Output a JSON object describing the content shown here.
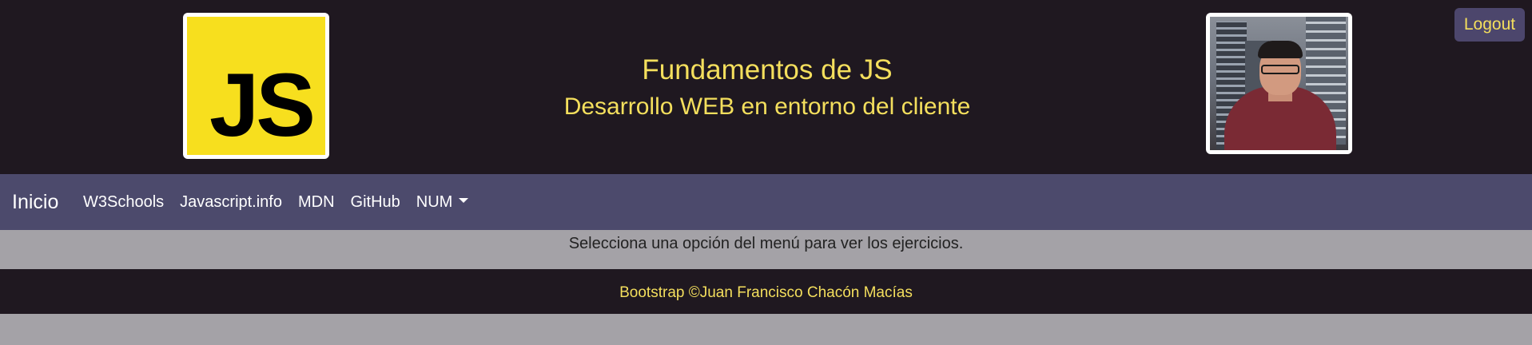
{
  "header": {
    "logo_text": "JS",
    "title": "Fundamentos de JS",
    "subtitle": "Desarrollo WEB en entorno del cliente",
    "logout_label": "Logout"
  },
  "navbar": {
    "brand": "Inicio",
    "links": [
      "W3Schools",
      "Javascript.info",
      "MDN",
      "GitHub"
    ],
    "dropdown_label": "NUM"
  },
  "content": {
    "message": "Selecciona una opción del menú para ver los ejercicios."
  },
  "footer": {
    "text": "Bootstrap ©Juan Francisco Chacón Macías"
  },
  "colors": {
    "dark_bg": "#1f1820",
    "nav_bg": "#4c4a6c",
    "accent_yellow": "#f4df5d",
    "page_bg": "#a4a2a7",
    "js_yellow": "#f7df1e"
  }
}
